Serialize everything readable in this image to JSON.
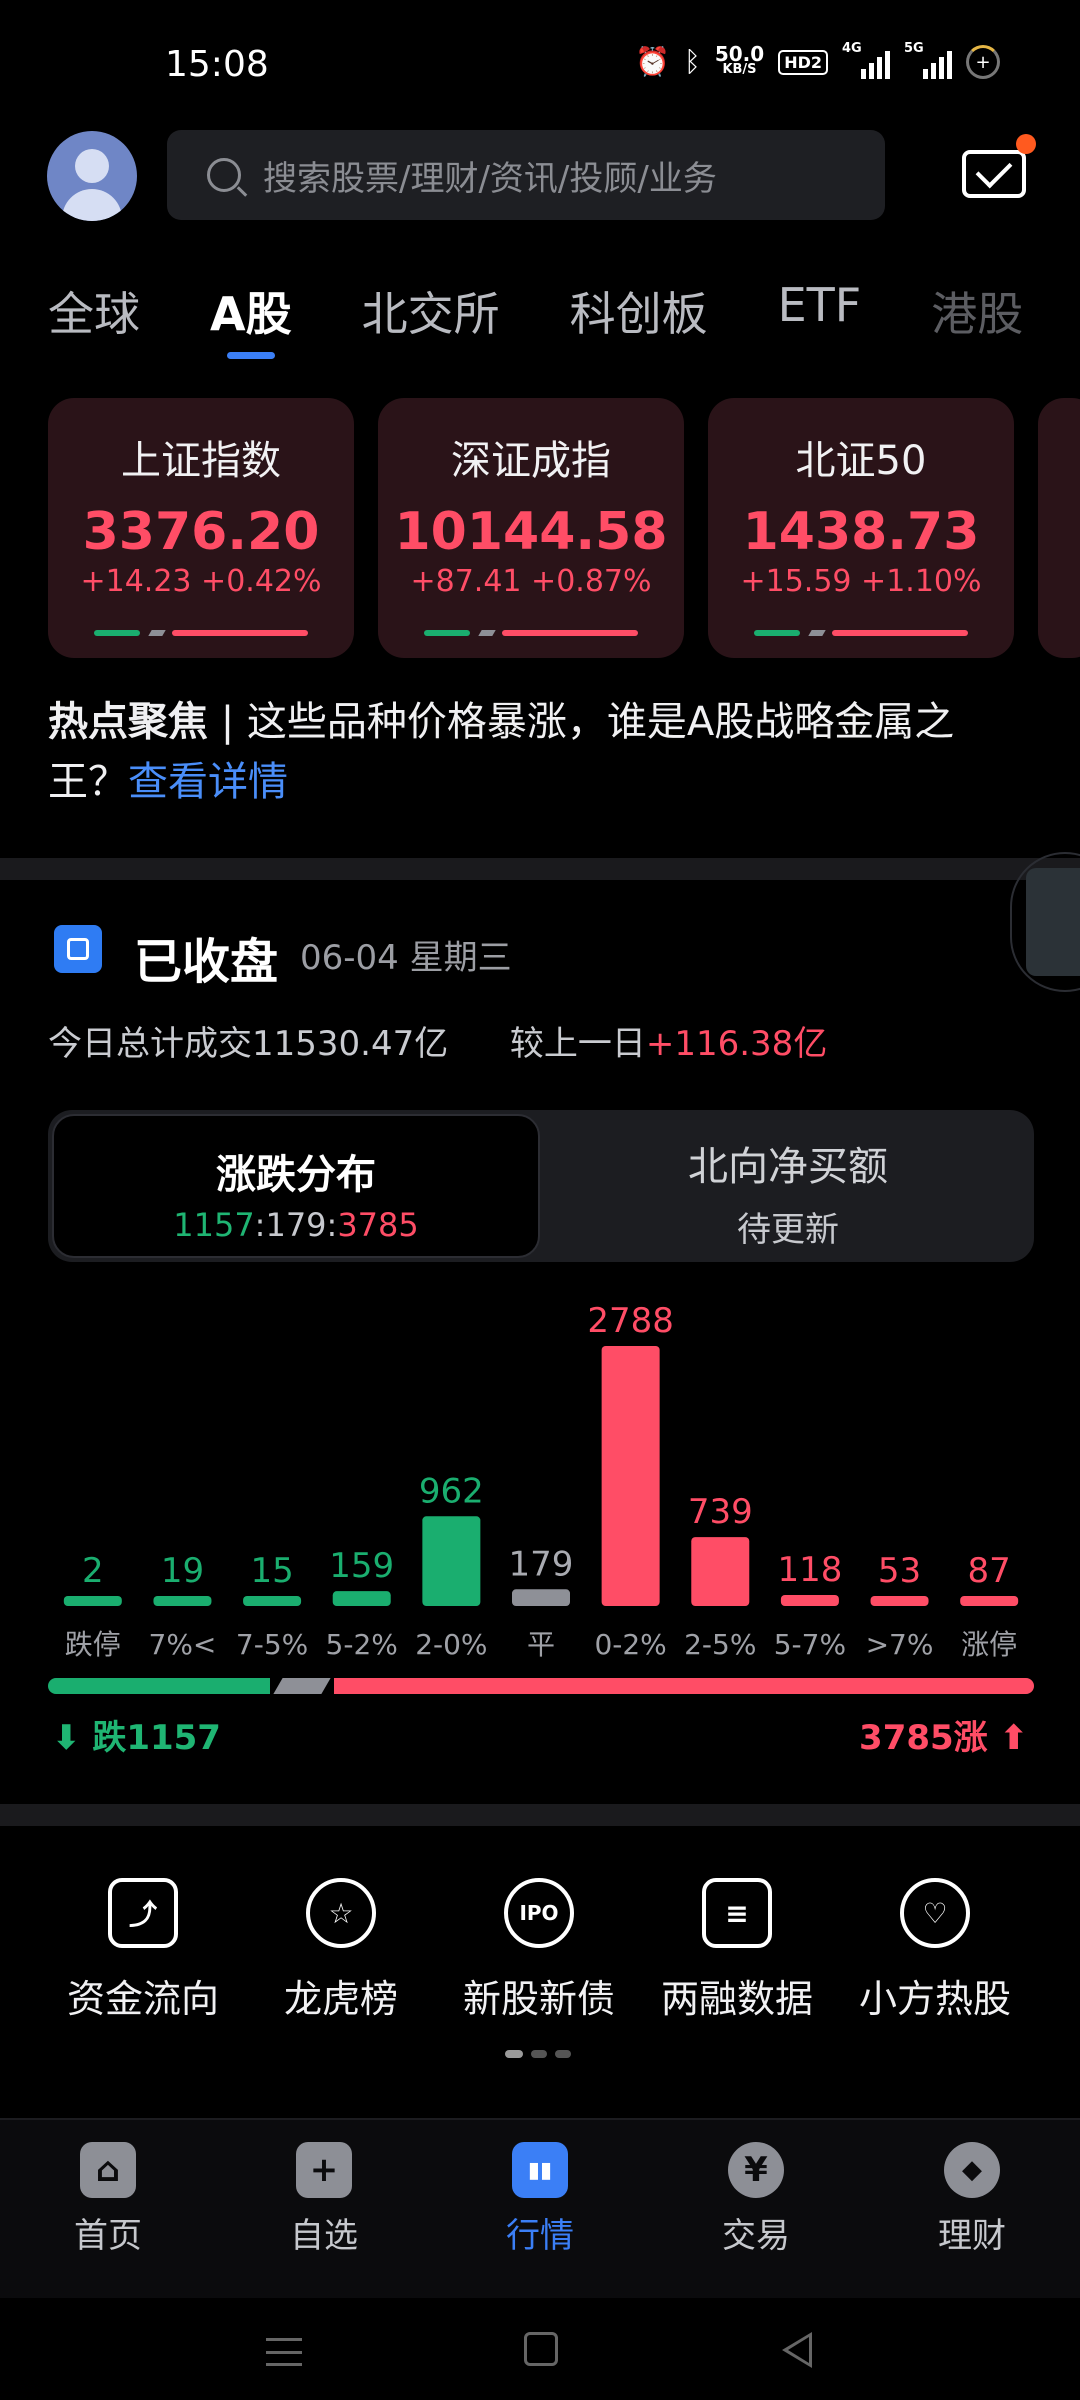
{
  "status_bar": {
    "time": "15:08",
    "net_speed_value": "50.0",
    "net_speed_unit": "KB/S",
    "hd_badge": "HD2",
    "sig1_label": "4G",
    "sig2_label": "5G"
  },
  "header": {
    "search_placeholder": "搜索股票/理财/资讯/投顾/业务",
    "mail_has_notification": true
  },
  "tabs": [
    {
      "label": "全球",
      "active": false
    },
    {
      "label": "A股",
      "active": true
    },
    {
      "label": "北交所",
      "active": false
    },
    {
      "label": "科创板",
      "active": false
    },
    {
      "label": "ETF",
      "active": false
    },
    {
      "label": "港股",
      "active": false
    }
  ],
  "index_cards": [
    {
      "name": "上证指数",
      "value": "3376.20",
      "change": "+14.23 +0.42%"
    },
    {
      "name": "深证成指",
      "value": "10144.58",
      "change": "+87.41 +0.87%"
    },
    {
      "name": "北证50",
      "value": "1438.73",
      "change": "+15.59 +1.10%"
    }
  ],
  "headline": {
    "tag": "热点聚焦",
    "text": " | 这些品种价格暴涨，谁是A股战略金属之王？",
    "link": "查看详情"
  },
  "market": {
    "status": "已收盘",
    "date": "06-04 星期三",
    "turnover_label": "今日总计成交11530.47亿",
    "compare_label": "较上一日",
    "compare_value": "+116.38亿",
    "seg_left_title": "涨跌分布",
    "ratio_down": "1157",
    "ratio_sep1": ":",
    "ratio_flat": "179",
    "ratio_sep2": ":",
    "ratio_up": "3785",
    "seg_right_title": "北向净买额",
    "seg_right_value": "待更新",
    "down_total": "⬇ 跌1157",
    "up_total": "3785涨 ⬆"
  },
  "colors": {
    "up": "#ff4d66",
    "down": "#1aae6f",
    "flat": "#8e9097",
    "accent": "#3b7ff6"
  },
  "chart_data": {
    "type": "bar",
    "categories": [
      "跌停",
      "7%<",
      "7-5%",
      "5-2%",
      "2-0%",
      "平",
      "0-2%",
      "2-5%",
      "5-7%",
      ">7%",
      "涨停"
    ],
    "values": [
      2,
      19,
      15,
      159,
      962,
      179,
      2788,
      739,
      118,
      53,
      87
    ],
    "bar_groups": [
      "down",
      "down",
      "down",
      "down",
      "down",
      "flat",
      "up",
      "up",
      "up",
      "up",
      "up"
    ],
    "title": "",
    "xlabel": "",
    "ylabel": ""
  },
  "shortcuts": [
    {
      "label": "资金流向",
      "icon": "fund-flow-icon",
      "glyph": "⤴"
    },
    {
      "label": "龙虎榜",
      "icon": "dragon-tiger-icon",
      "glyph": "☆"
    },
    {
      "label": "新股新债",
      "icon": "ipo-icon",
      "glyph": "IPO"
    },
    {
      "label": "两融数据",
      "icon": "margin-data-icon",
      "glyph": "≡"
    },
    {
      "label": "小方热股",
      "icon": "hot-stock-icon",
      "glyph": "♡"
    }
  ],
  "bottom_nav": [
    {
      "label": "首页",
      "icon": "home-icon",
      "glyph": "⌂",
      "active": false
    },
    {
      "label": "自选",
      "icon": "watchlist-add-icon",
      "glyph": "+",
      "active": false
    },
    {
      "label": "行情",
      "icon": "market-chart-icon",
      "glyph": "▮▮",
      "active": true
    },
    {
      "label": "交易",
      "icon": "trade-yen-icon",
      "glyph": "¥",
      "active": false
    },
    {
      "label": "理财",
      "icon": "wealth-diamond-icon",
      "glyph": "◆",
      "active": false
    }
  ]
}
